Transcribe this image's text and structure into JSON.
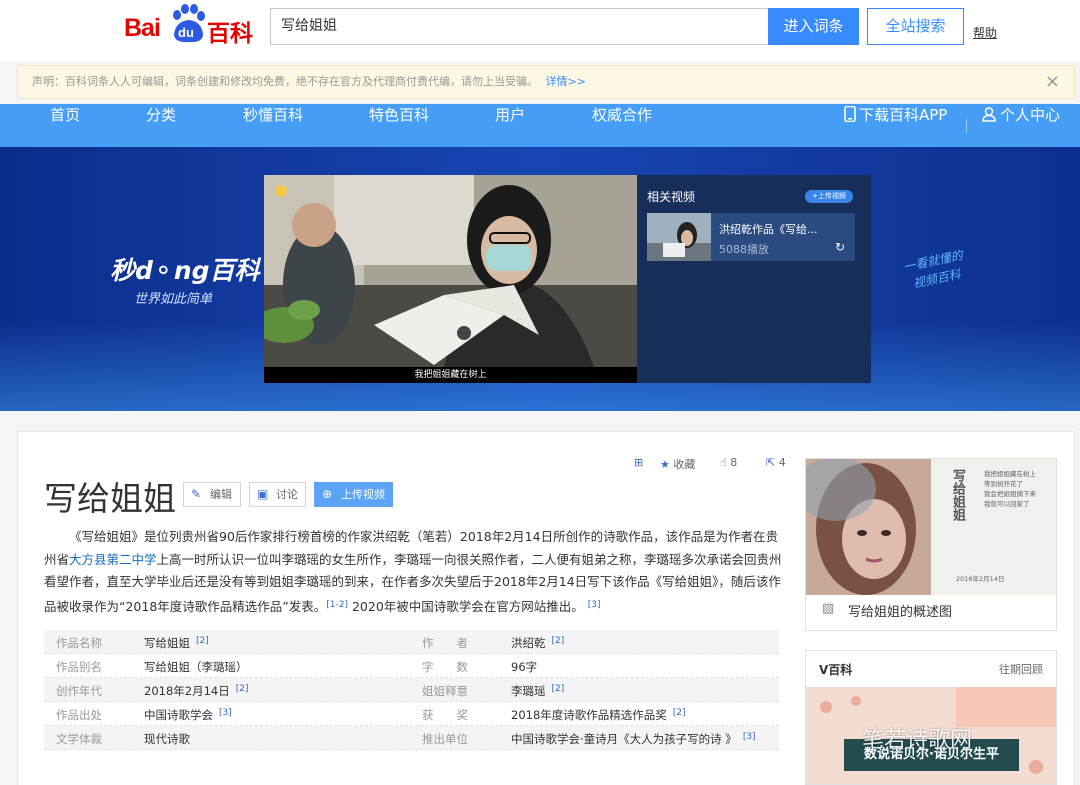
{
  "header": {
    "logo_bai": "Bai",
    "logo_du": "du",
    "logo_baike": "百科",
    "search_value": "写给姐姐",
    "enter_label": "进入词条",
    "search_all_label": "全站搜索",
    "help_label": "帮助"
  },
  "notice": {
    "text": "声明：百科词条人人可编辑，词条创建和修改均免费，绝不存在官方及代理商付费代编，请勿上当受骗。",
    "more": "详情>>",
    "close": "×"
  },
  "nav": {
    "items": [
      "首页",
      "分类",
      "秒懂百科",
      "特色百科",
      "用户",
      "权威合作"
    ],
    "download_app": "下载百科APP",
    "user_center": "个人中心"
  },
  "banner": {
    "brand": "秒d⚬ng百科",
    "brand_sub": "世界如此简单",
    "subtitle": "我把姐姐藏在树上",
    "related_title": "相关视频",
    "upload_label": "+上传视频",
    "video_title": "洪绍乾作品《写给...",
    "video_plays": "5088播放",
    "slogan_line1": "一看就懂的",
    "slogan_line2": "视频百科"
  },
  "entry": {
    "title": "写给姐姐",
    "edit_label": "编辑",
    "discuss_label": "讨论",
    "upload_video_label": "上传视频",
    "collect_label": "收藏",
    "like_count": "8",
    "share_count": "4",
    "summary_p1": "《写给姐姐》是位列贵州省90后作家排行榜首榜的作家洪绍乾（笔若）2018年2月14日所创作的诗歌作品，该作品是为作者在贵州省",
    "summary_link": "大方县第二中学",
    "summary_p2": "上高一时所认识一位叫李璐瑶的女生所作，李璐瑶一向很关照作者，二人便有姐弟之称，李璐瑶多次承诺会回贵州看望作者，直至大学毕业后还是没有等到姐姐李璐瑶的到来，在作者多次失望后于2018年2月14日写下该作品《写给姐姐》，随后该作品被收录作为“2018年度诗歌作品精选作品”发表。",
    "summary_ref1": "[1-2]",
    "summary_p3": "2020年被中国诗歌学会在官方网站推出。",
    "summary_ref2": "[3]"
  },
  "info": {
    "rows": [
      {
        "k1": "作品名称",
        "v1": "写给姐姐",
        "r1": "[2]",
        "k2": "作　　者",
        "v2": "洪绍乾",
        "r2": "[2]"
      },
      {
        "k1": "作品别名",
        "v1": "写给姐姐（李璐瑶）",
        "r1": "",
        "k2": "字　　数",
        "v2": "96字",
        "r2": ""
      },
      {
        "k1": "创作年代",
        "v1": "2018年2月14日",
        "r1": "[2]",
        "k2": "姐姐释意",
        "v2": "李璐瑶",
        "r2": "[2]"
      },
      {
        "k1": "作品出处",
        "v1": "中国诗歌学会",
        "r1": "[3]",
        "k2": "获　　奖",
        "v2": "2018年度诗歌作品精选作品奖",
        "r2": "[2]"
      },
      {
        "k1": "文学体裁",
        "v1": "现代诗歌",
        "r1": "",
        "k2": "推出单位",
        "v2": "中国诗歌学会·童诗月《大人为孩子写的诗 》",
        "r2": "[3]"
      }
    ]
  },
  "sidebar": {
    "overview_caption": "写给姐姐的概述图",
    "poem_title": "写给姐姐",
    "poem_lines": [
      "我把姐姐藏在树上",
      "等到树开花了",
      "我会把姐姐摘下来",
      "我就可以回家了"
    ],
    "poem_date": "2018年2月14日",
    "vbaike_title": "V百科",
    "vbaike_past": "往期回顾",
    "vbaike_label": "数说诺贝尔·诺贝尔生平",
    "watermark": "笔若诗歌网"
  },
  "colors": {
    "brand_red": "#e10602",
    "primary_blue": "#388bff",
    "nav_blue": "#459df5",
    "link_blue": "#136ec2"
  }
}
